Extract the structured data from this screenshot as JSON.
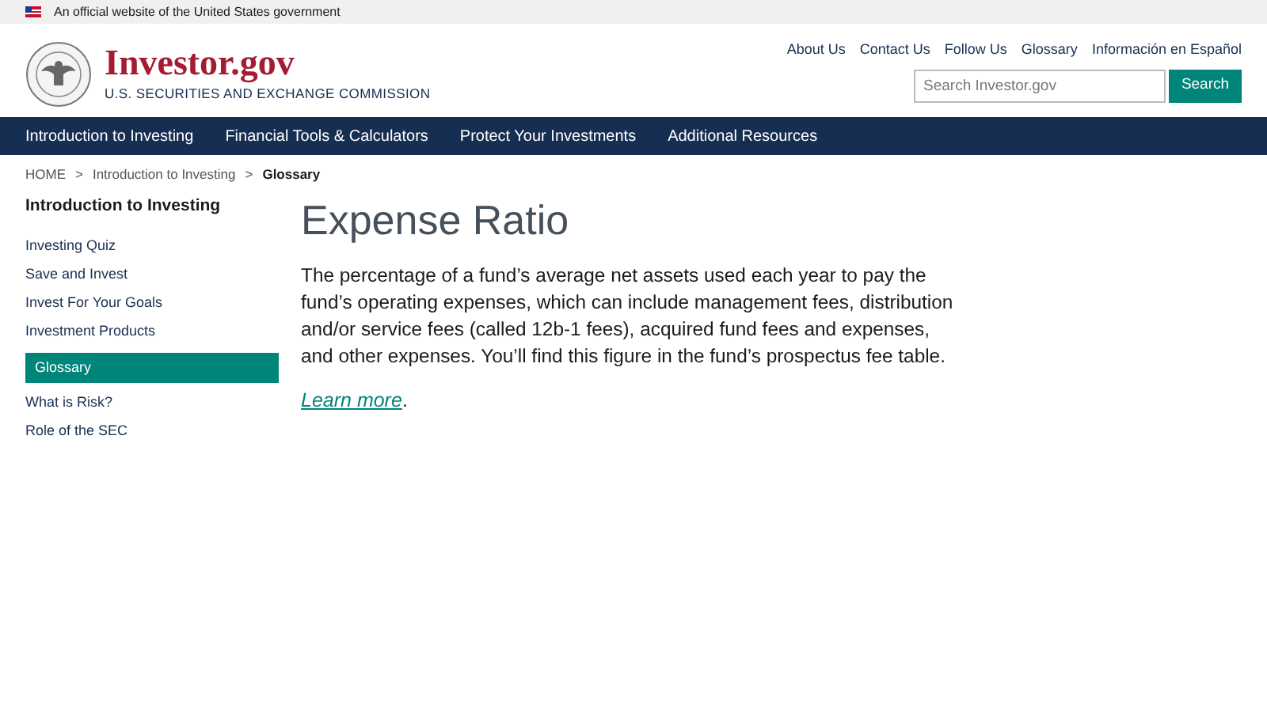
{
  "gov_banner": {
    "text": "An official website of the United States government"
  },
  "header": {
    "site_name": "Investor.gov",
    "agency": "U.S. SECURITIES AND EXCHANGE COMMISSION",
    "utility_links": [
      "About Us",
      "Contact Us",
      "Follow Us",
      "Glossary",
      "Información en Español"
    ],
    "search": {
      "placeholder": "Search Investor.gov",
      "button": "Search"
    }
  },
  "nav": [
    "Introduction to Investing",
    "Financial Tools & Calculators",
    "Protect Your Investments",
    "Additional Resources"
  ],
  "breadcrumb": [
    {
      "kind": "link",
      "text": "HOME"
    },
    {
      "kind": "separator",
      "text": ">"
    },
    {
      "kind": "link",
      "text": "Introduction to Investing"
    },
    {
      "kind": "separator",
      "text": ">"
    },
    {
      "kind": "current",
      "text": "Glossary"
    }
  ],
  "sidebar": {
    "title": "Introduction to Investing",
    "items": [
      {
        "label": "Investing Quiz",
        "selected": false
      },
      {
        "label": "Save and Invest",
        "selected": false
      },
      {
        "label": "Invest For Your Goals",
        "selected": false
      },
      {
        "label": "Investment Products",
        "selected": false
      },
      {
        "label": "Glossary",
        "selected": true
      },
      {
        "label": "What is Risk?",
        "selected": false
      },
      {
        "label": "Role of the SEC",
        "selected": false
      }
    ]
  },
  "article": {
    "title": "Expense Ratio",
    "body": "The percentage of a fund’s average net assets used each year to pay the fund’s operating expenses, which can include management fees, distribution and/or service fees (called 12b-1 fees), acquired fund fees and expenses, and other expenses. You’ll find this figure in the fund’s prospectus fee table.",
    "link": "Learn more",
    "link_suffix": "."
  }
}
